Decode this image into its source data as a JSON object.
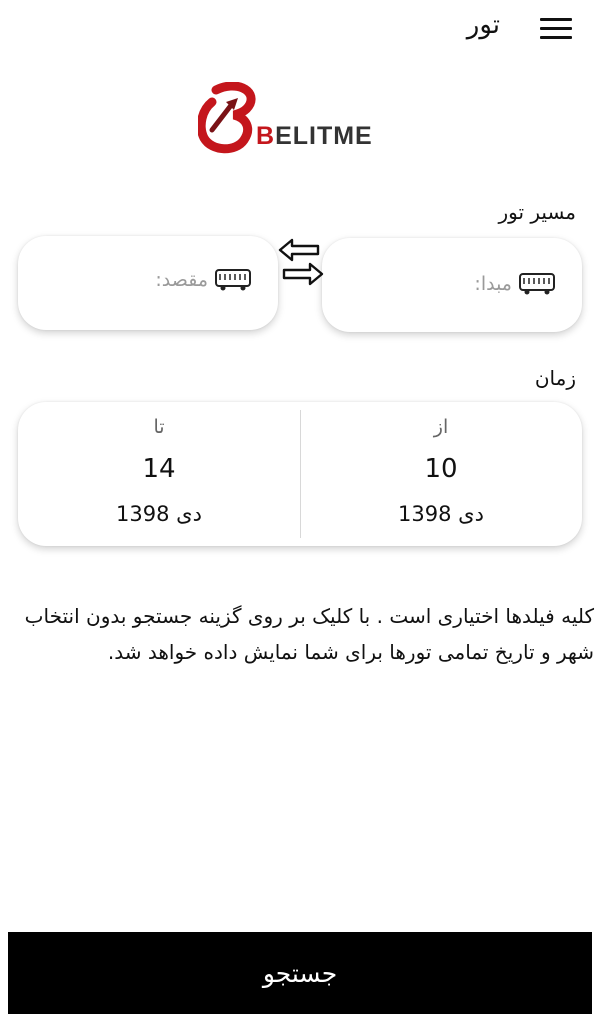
{
  "header": {
    "title": "تور",
    "menu_icon": "hamburger-menu-icon"
  },
  "logo": {
    "text_b": "B",
    "text_rest": "ELITME",
    "brand_color": "#c4161c"
  },
  "route": {
    "section_label": "مسیر تور",
    "origin_placeholder": "مبدا:",
    "destination_placeholder": "مقصد:",
    "field_icon": "bus-icon",
    "swap_icon": "swap-arrows-icon"
  },
  "time": {
    "section_label": "زمان",
    "from": {
      "caption": "از",
      "day": "10",
      "month_year": "دی 1398"
    },
    "to": {
      "caption": "تا",
      "day": "14",
      "month_year": "دی 1398"
    }
  },
  "info_text": "کلیه فیلدها اختیاری است . با کلیک بر روی گزینه جستجو بدون انتخاب شهر و تاریخ تمامی تورها برای شما نمایش داده خواهد شد.",
  "search_button": "جستجو"
}
